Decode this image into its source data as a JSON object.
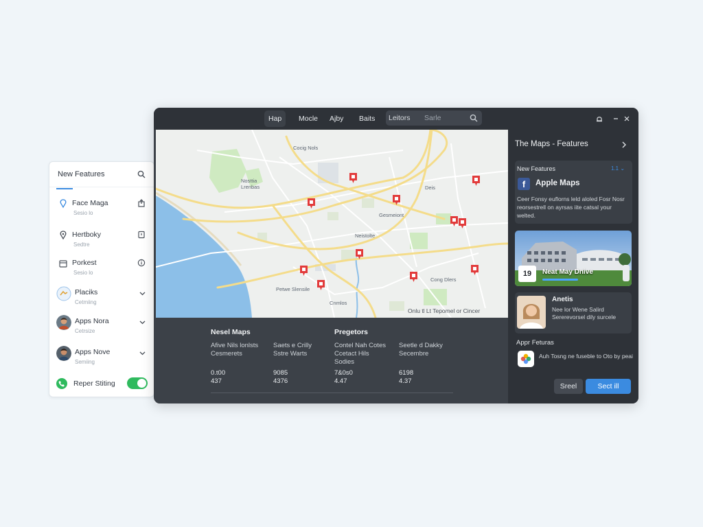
{
  "left_panel": {
    "title": "New Features",
    "items": [
      {
        "title": "Face Maga",
        "sub": "Sesio lo"
      },
      {
        "title": "Hertboky",
        "sub": "Sedtre"
      },
      {
        "title": "Porkest",
        "sub": "Sesio lo"
      },
      {
        "title": "Placiks",
        "sub": "Cetmiing"
      },
      {
        "title": "Apps Nora",
        "sub": "Cetrsize"
      },
      {
        "title": "Apps Nove",
        "sub": "Semiing"
      }
    ],
    "toggle_label": "Reper Stiting",
    "toggle_on": true
  },
  "window": {
    "tabs": [
      "Hap",
      "Mocle",
      "Ajby",
      "Baits"
    ],
    "active_tab": "Hap",
    "search": {
      "label": "Leitors",
      "placeholder": "Sarle"
    }
  },
  "map": {
    "labels": [
      "Cocig Nols",
      "Nosttia Lrenbas",
      "Gesmeiont",
      "Neistolte",
      "Petwe Slensile",
      "Cong Dlers",
      "Cnmlos",
      "Deis"
    ],
    "attribution": "Onlu tl Lt Tepomel or Cincer"
  },
  "table": {
    "headers": [
      "Nesel Maps",
      "Pregetors"
    ],
    "columns": [
      {
        "lines": [
          "Afive Nils lonlsts",
          "Cesmerets"
        ],
        "nums": [
          "0.t00",
          "437"
        ]
      },
      {
        "lines": [
          "Saets e Crilly",
          "Sstre Warts"
        ],
        "nums": [
          "9085",
          "4376"
        ]
      },
      {
        "lines": [
          "Contel Nah Cotes",
          "Ccetact Hils",
          "Sodies"
        ],
        "nums": [
          "7&0s0",
          "4.47"
        ]
      },
      {
        "lines": [
          "Seetle d Dakky",
          "Secembre"
        ],
        "nums": [
          "6198",
          "4.37"
        ]
      }
    ]
  },
  "right_panel": {
    "title": "The Maps - Features",
    "card1": {
      "header": "New Features",
      "badge": "1.1",
      "app": "Apple Maps",
      "desc": "Ceer Fonsy euflorns leld aloled Fosr Nosr reorsestrell on ayrsas iite catsal your welted."
    },
    "card2": {
      "date": "19",
      "text": "Neat May Dnive"
    },
    "card3": {
      "name": "Anetis",
      "desc": "Nee lor Wene Salird Sererevorsel dily surcele"
    },
    "app_features": {
      "header": "Appr Feturas",
      "text": "Auh Tosng ne fuseble to Oto by peai"
    },
    "btn_secondary": "Sreel",
    "btn_primary": "Sect ill"
  },
  "colors": {
    "accent": "#3b8be0",
    "pin": "#e23b3b",
    "toggle": "#2fba5e",
    "water": "#8cbfe8",
    "park": "#cfeac1",
    "road": "#f4dc8a"
  }
}
